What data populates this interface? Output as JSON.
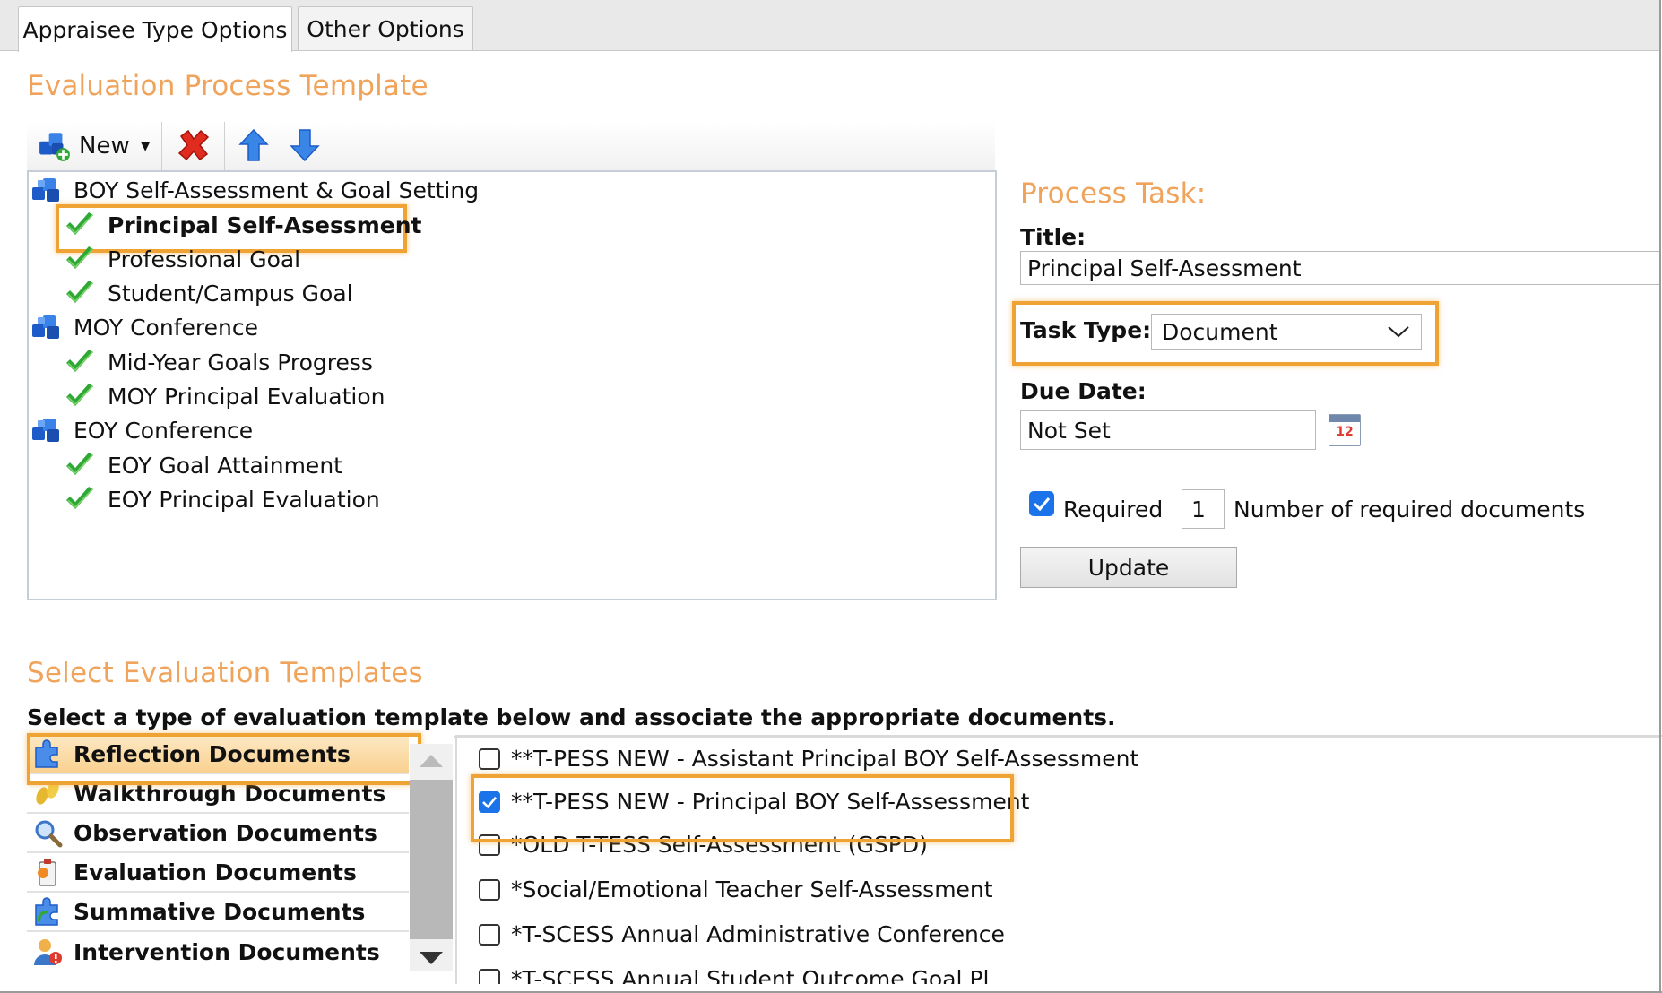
{
  "tabs": [
    {
      "label": "Appraisee Type Options",
      "active": true
    },
    {
      "label": "Other Options",
      "active": false
    }
  ],
  "process_template": {
    "title": "Evaluation Process Template",
    "toolbar": {
      "new_label": "New"
    },
    "tree": [
      {
        "label": "BOY Self-Assessment & Goal Setting",
        "level": 0,
        "icon": "group-icon"
      },
      {
        "label": "Principal Self-Asessment",
        "level": 1,
        "icon": "check-icon",
        "selected": true
      },
      {
        "label": "Professional Goal",
        "level": 1,
        "icon": "check-icon"
      },
      {
        "label": "Student/Campus Goal",
        "level": 1,
        "icon": "check-icon"
      },
      {
        "label": "MOY Conference",
        "level": 0,
        "icon": "group-icon"
      },
      {
        "label": "Mid-Year Goals Progress",
        "level": 1,
        "icon": "check-icon"
      },
      {
        "label": "MOY Principal Evaluation",
        "level": 1,
        "icon": "check-icon"
      },
      {
        "label": "EOY Conference",
        "level": 0,
        "icon": "group-icon"
      },
      {
        "label": "EOY Goal Attainment",
        "level": 1,
        "icon": "check-icon"
      },
      {
        "label": "EOY Principal Evaluation",
        "level": 1,
        "icon": "check-icon"
      }
    ]
  },
  "process_task": {
    "heading": "Process Task:",
    "title_label": "Title:",
    "title_value": "Principal Self-Asessment",
    "task_type_label": "Task Type:",
    "task_type_value": "Document",
    "due_date_label": "Due Date:",
    "due_date_value": "Not Set",
    "calendar_day": "12",
    "required_label": "Required",
    "required_checked": true,
    "num_docs_value": "1",
    "num_docs_label": "Number of required documents",
    "update_label": "Update"
  },
  "eval_templates": {
    "title": "Select Evaluation Templates",
    "instruction": "Select a type of evaluation template below and associate the appropriate documents.",
    "categories": [
      {
        "label": "Reflection Documents",
        "icon": "puzzle-icon",
        "active": true
      },
      {
        "label": "Walkthrough Documents",
        "icon": "footprints-icon"
      },
      {
        "label": "Observation Documents",
        "icon": "magnifier-icon"
      },
      {
        "label": "Evaluation Documents",
        "icon": "clipboard-icon"
      },
      {
        "label": "Summative Documents",
        "icon": "puzzle-recycle-icon"
      },
      {
        "label": "Intervention Documents",
        "icon": "user-alert-icon"
      }
    ],
    "documents": [
      {
        "label": "**T-PESS NEW - Assistant Principal BOY Self-Assessment",
        "checked": false
      },
      {
        "label": "**T-PESS NEW - Principal BOY Self-Assessment",
        "checked": true
      },
      {
        "label": "*OLD T-TESS Self-Assessment (GSPD)",
        "checked": false
      },
      {
        "label": "*Social/Emotional Teacher Self-Assessment",
        "checked": false
      },
      {
        "label": "*T-SCESS Annual Administrative Conference",
        "checked": false
      },
      {
        "label": "*T-SCESS Annual Student Outcome Goal Pl",
        "checked": false
      }
    ]
  },
  "colors": {
    "accent": "#f0a35a",
    "highlight": "#f0a335",
    "check": "#2fa836",
    "checkbox": "#1a73e8"
  }
}
